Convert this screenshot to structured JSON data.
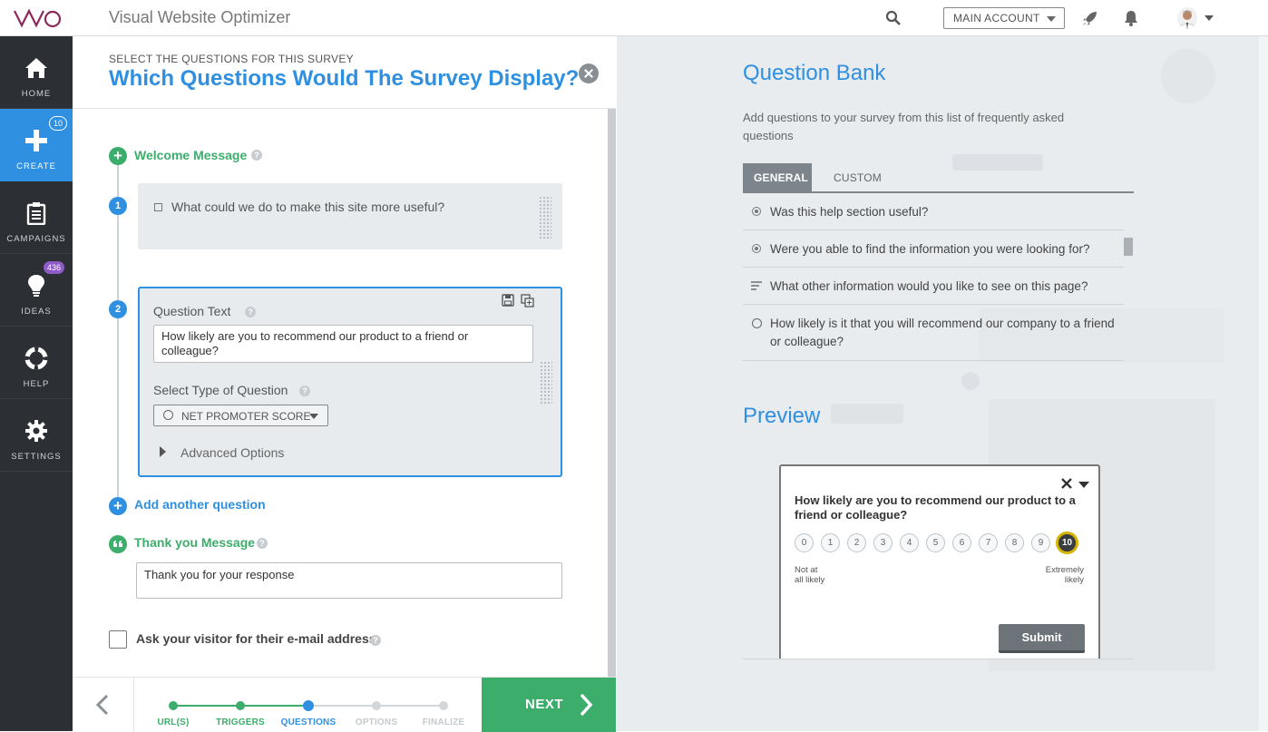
{
  "app": {
    "title": "Visual Website Optimizer",
    "account": "MAIN ACCOUNT"
  },
  "sidebar": {
    "items": [
      {
        "label": "HOME",
        "icon": "home-icon"
      },
      {
        "label": "CREATE",
        "icon": "plus-icon",
        "badge": "10"
      },
      {
        "label": "CAMPAIGNS",
        "icon": "clipboard-icon"
      },
      {
        "label": "IDEAS",
        "icon": "lightbulb-icon",
        "badge": "436"
      },
      {
        "label": "HELP",
        "icon": "lifebuoy-icon"
      },
      {
        "label": "SETTINGS",
        "icon": "gear-icon"
      }
    ]
  },
  "survey": {
    "kicker": "SELECT THE QUESTIONS FOR THIS SURVEY",
    "title": "Which Questions Would The Survey Display?",
    "welcome_label": "Welcome Message",
    "q1": {
      "number": "1",
      "text": "What could we do to make this site more useful?"
    },
    "q2": {
      "number": "2",
      "question_text_label": "Question Text",
      "question_text_value": "How likely are you to recommend our product to a friend or colleague?",
      "type_label": "Select Type of Question",
      "type_value": "NET PROMOTER SCORE",
      "advanced_label": "Advanced Options"
    },
    "add_question_label": "Add another question",
    "thanks_label": "Thank you Message",
    "thanks_value": "Thank you for your response",
    "email_checkbox_label": "Ask your visitor for their e-mail address",
    "email_checked": false
  },
  "wizard": {
    "steps": [
      "URL(S)",
      "TRIGGERS",
      "QUESTIONS",
      "OPTIONS",
      "FINALIZE"
    ],
    "current_step": "QUESTIONS",
    "next_label": "NEXT"
  },
  "question_bank": {
    "title": "Question Bank",
    "subtitle": "Add questions to your survey from this list of frequently asked questions",
    "tabs": [
      "GENERAL",
      "CUSTOM"
    ],
    "active_tab": "GENERAL",
    "questions": [
      {
        "text": "Was this help section useful?",
        "icon": "radio-icon"
      },
      {
        "text": "Were you able to find the information you were looking for?",
        "icon": "radio-icon"
      },
      {
        "text": "What other information would you like to see on this page?",
        "icon": "text-lines-icon"
      },
      {
        "text": "How likely is it that you will recommend our company to a friend or colleague?",
        "icon": "smiley-icon"
      }
    ]
  },
  "preview": {
    "title": "Preview",
    "question": "How likely are you to recommend our product to a friend or colleague?",
    "scale": [
      "0",
      "1",
      "2",
      "3",
      "4",
      "5",
      "6",
      "7",
      "8",
      "9",
      "10"
    ],
    "selected": "10",
    "low_label_1": "Not at",
    "low_label_2": "all likely",
    "high_label_1": "Extremely",
    "high_label_2": "likely",
    "submit_label": "Submit"
  },
  "colors": {
    "accent": "#2f8fe0",
    "green": "#3cad6b",
    "sidebar": "#2c2f33",
    "selected_ring": "#d4b400"
  }
}
